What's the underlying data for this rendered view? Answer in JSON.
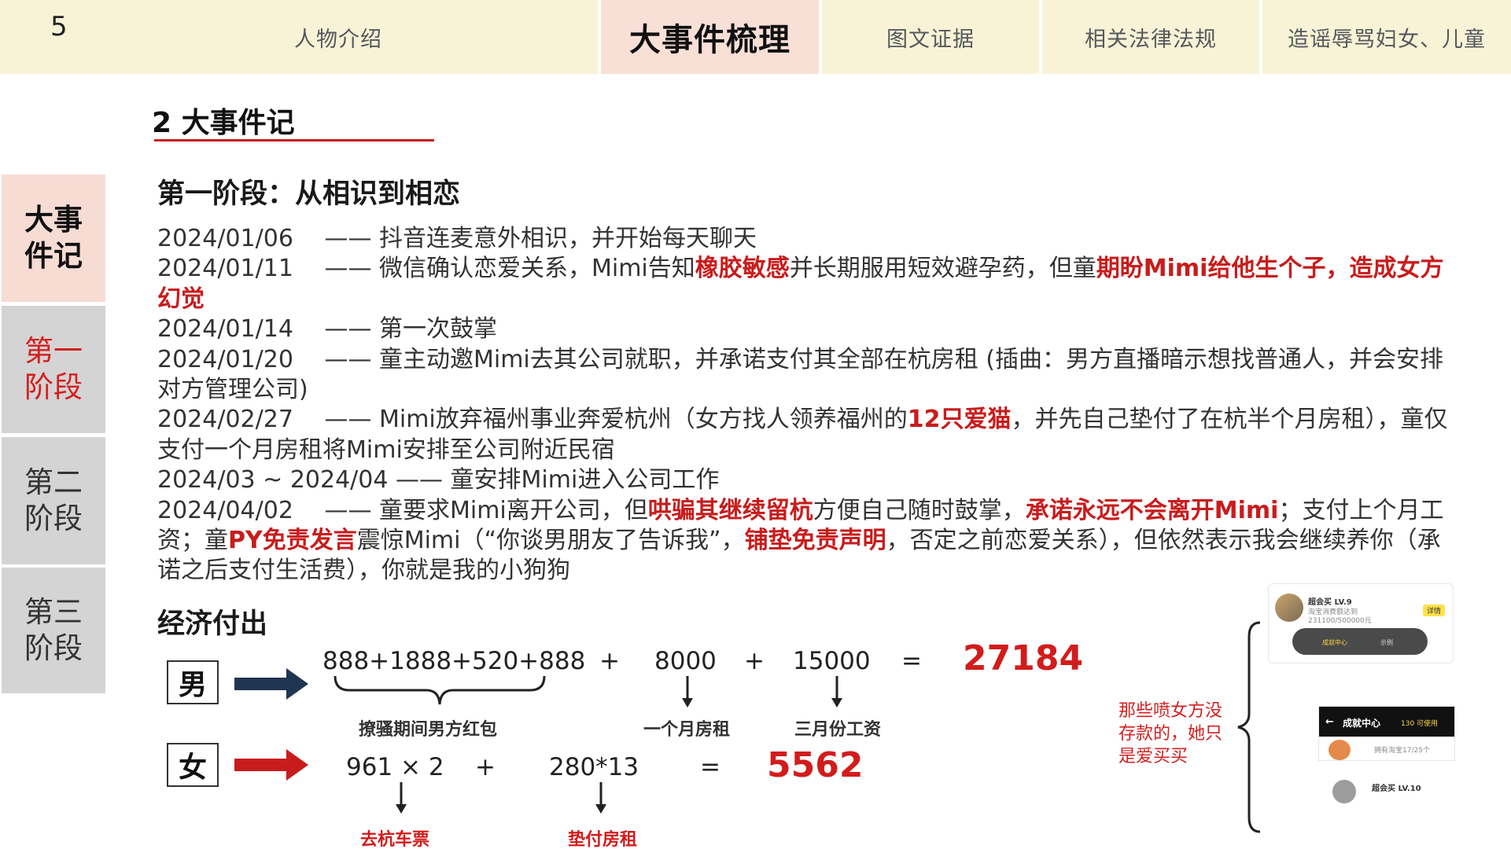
{
  "top_nav": {
    "page_number": "5",
    "tabs": [
      {
        "label": "人物介绍"
      },
      {
        "label": "大事件梳理"
      },
      {
        "label": "图文证据"
      },
      {
        "label": "相关法律法规"
      },
      {
        "label": "造谣辱骂妇女、儿童"
      }
    ]
  },
  "side_nav": [
    {
      "label": "大事件记"
    },
    {
      "label": "第一阶段"
    },
    {
      "label": "第二阶段"
    },
    {
      "label": "第三阶段"
    }
  ],
  "section_title": "2 大事件记",
  "phase_title": "第一阶段：从相识到相恋",
  "timeline": [
    {
      "segments": [
        {
          "t": "2024/01/06　 —— 抖音连麦意外相识，并开始每天聊天"
        }
      ]
    },
    {
      "segments": [
        {
          "t": "2024/01/11　 —— 微信确认恋爱关系，Mimi告知"
        },
        {
          "t": "橡胶敏感",
          "hl": true
        },
        {
          "t": "并长期服用短效避孕药，但童"
        },
        {
          "t": "期盼Mimi给他生个子，造成女方幻觉",
          "hl": true
        }
      ]
    },
    {
      "segments": [
        {
          "t": "2024/01/14　 —— 第一次鼓掌"
        }
      ]
    },
    {
      "segments": [
        {
          "t": "2024/01/20　 —— 童主动邀Mimi去其公司就职，并承诺支付其全部在杭房租 (插曲：男方直播暗示想找普通人，并会安排对方管理公司)"
        }
      ]
    },
    {
      "segments": [
        {
          "t": "2024/02/27　 —— Mimi放弃福州事业奔爱杭州（女方找人领养福州的"
        },
        {
          "t": "12只爱猫",
          "hl": true
        },
        {
          "t": "，并先自己垫付了在杭半个月房租），童仅支付一个月房租将Mimi安排至公司附近民宿"
        }
      ]
    },
    {
      "segments": [
        {
          "t": "2024/03 ~ 2024/04 —— 童安排Mimi进入公司工作"
        }
      ]
    },
    {
      "segments": [
        {
          "t": "2024/04/02　 —— 童要求Mimi离开公司，但"
        },
        {
          "t": "哄骗其继续留杭",
          "hl": true
        },
        {
          "t": "方便自己随时鼓掌，"
        },
        {
          "t": "承诺永远不会离开Mimi",
          "hl": true
        },
        {
          "t": "；支付上个月工资；童"
        },
        {
          "t": "PY免责发言",
          "hl": true
        },
        {
          "t": "震惊Mimi（“你谈男朋友了告诉我”，"
        },
        {
          "t": "铺垫免责声明",
          "hl": true
        },
        {
          "t": "，否定之前恋爱关系），但依然表示我会继续养你（承诺之后支付生活费），你就是我的小狗狗"
        }
      ]
    }
  ],
  "economics": {
    "title": "经济付出",
    "male": {
      "label": "男",
      "term1": "888+1888+520+888",
      "term1_caption": "撩骚期间男方红包",
      "term2": "8000",
      "term2_caption": "一个月房租",
      "term3": "15000",
      "term3_caption": "三月份工资",
      "plus": "+",
      "equals": "=",
      "total": "27184"
    },
    "female": {
      "label": "女",
      "term1": "961 × 2",
      "term1_caption": "去杭车票",
      "term2": "280*13",
      "term2_caption": "垫付房租",
      "plus": "+",
      "equals": "=",
      "total": "5562"
    }
  },
  "side_note": "那些喷女方没存款的，她只是爱买买",
  "screenshots": {
    "top_title": "超会买 LV.9",
    "top_sub1": "淘宝消费额达到",
    "top_sub2": "231100/500000元",
    "top_badge": "详情",
    "top_btn1": "成就中心",
    "top_btn2": "示例",
    "mid_title": "成就中心",
    "mid_badge": "130 可使用",
    "mid_sub": "拥有淘宝17/25个",
    "bottom_title": "超会买 LV.10"
  },
  "colors": {
    "nav_bg": "#f8f3d6",
    "nav_active_bg": "#f8e0d7",
    "highlight_red": "#c81c1c",
    "male_arrow": "#1f3552",
    "female_arrow": "#c81c1c"
  }
}
